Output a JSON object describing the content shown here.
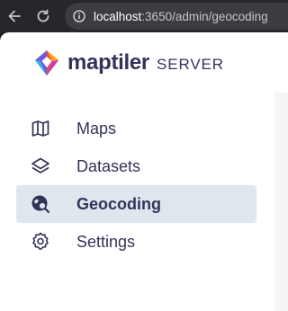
{
  "browser": {
    "url_host": "localhost",
    "url_rest": ":3650/admin/geocoding"
  },
  "brand": {
    "wordmark": "maptiler",
    "product": "SERVER",
    "colors": [
      "#ffaa01",
      "#ef4b4b",
      "#c33bbd",
      "#6d5adf",
      "#33b2e6",
      "#2e9b87"
    ]
  },
  "menu": {
    "items": [
      {
        "label": "Maps",
        "icon": "map-icon",
        "active": false
      },
      {
        "label": "Datasets",
        "icon": "layers-icon",
        "active": false
      },
      {
        "label": "Geocoding",
        "icon": "globe-search-icon",
        "active": true
      },
      {
        "label": "Settings",
        "icon": "gear-icon",
        "active": false
      }
    ]
  },
  "colors": {
    "text": "#333359",
    "active_bg": "#dfe7ee",
    "browser_chrome": "#26272b"
  }
}
